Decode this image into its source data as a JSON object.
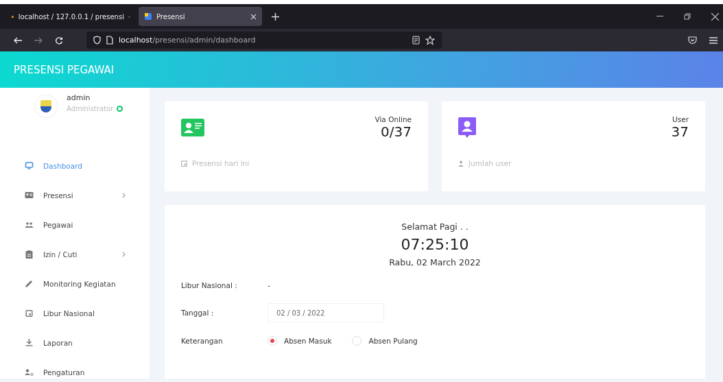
{
  "browser": {
    "tabs": [
      {
        "title": "localhost / 127.0.0.1 / presensi",
        "selected": false
      },
      {
        "title": "Presensi",
        "selected": true
      }
    ],
    "url_host": "localhost",
    "url_path": "/presensi/admin/dashboard"
  },
  "header": {
    "title": "PRESENSI PEGAWAI"
  },
  "user": {
    "name": "admin",
    "role": "Administrator",
    "online": true
  },
  "sidebar": {
    "items": [
      {
        "label": "Dashboard",
        "selected": true,
        "submenu": false
      },
      {
        "label": "Presensi",
        "selected": false,
        "submenu": true
      },
      {
        "label": "Pegawai",
        "selected": false,
        "submenu": false
      },
      {
        "label": "Izin / Cuti",
        "selected": false,
        "submenu": true
      },
      {
        "label": "Monitoring Kegiatan",
        "selected": false,
        "submenu": false
      },
      {
        "label": "Libur Nasional",
        "selected": false,
        "submenu": false
      },
      {
        "label": "Laporan",
        "selected": false,
        "submenu": false
      },
      {
        "label": "Pengaturan",
        "selected": false,
        "submenu": false
      }
    ]
  },
  "stats": [
    {
      "caption": "Via Online",
      "value": "0/37",
      "footer": "Presensi hari ini",
      "color": "#22c55e"
    },
    {
      "caption": "User",
      "value": "37",
      "footer": "Jumlah user",
      "color": "#8b5cf6"
    }
  ],
  "clock": {
    "greeting": "Selamat Pagi . .",
    "time": "07:25:10",
    "date": "Rabu, 02 March 2022"
  },
  "form": {
    "holiday_label": "Libur Nasional :",
    "holiday_value": "-",
    "date_label": "Tanggal :",
    "date_value": "02 / 03 / 2022",
    "note_label": "Keterangan",
    "options": [
      {
        "label": "Absen Masuk",
        "selected": true
      },
      {
        "label": "Absen Pulang",
        "selected": false
      }
    ]
  }
}
